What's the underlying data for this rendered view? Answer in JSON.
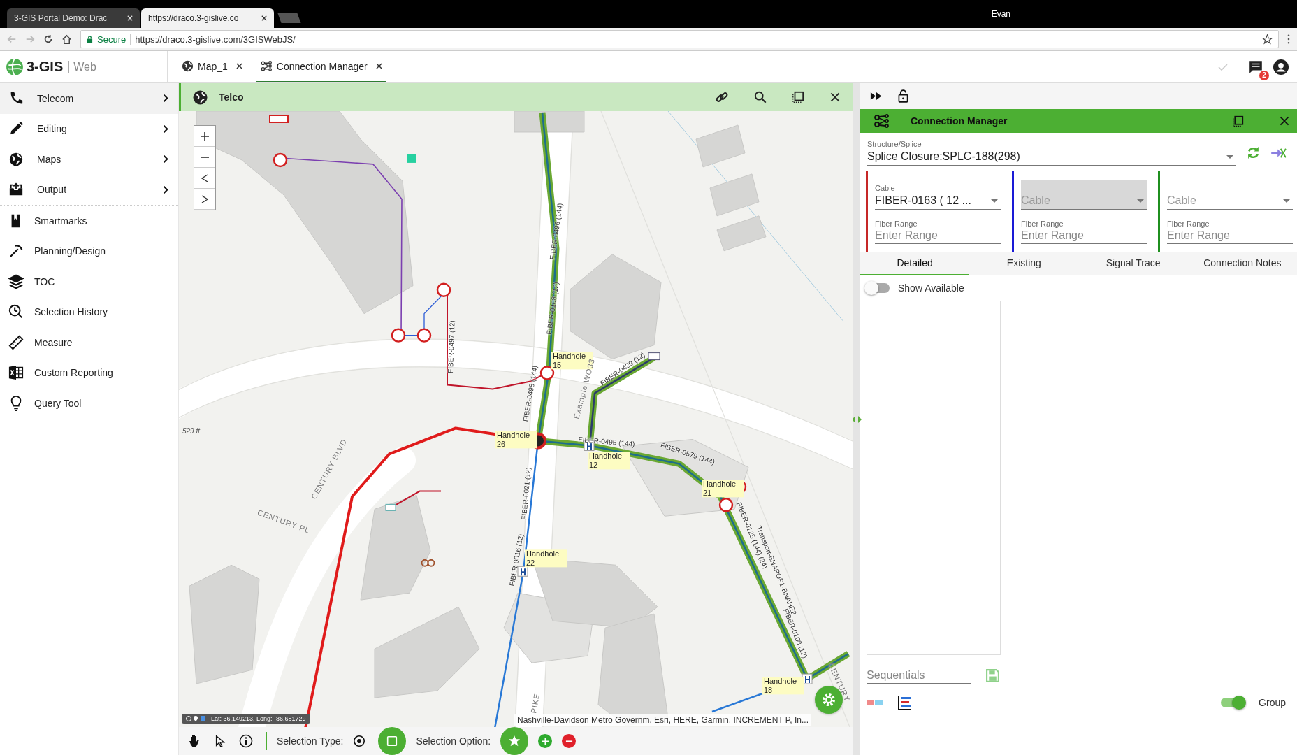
{
  "browser": {
    "tabs": [
      {
        "title": "3-GIS Portal Demo: Drac",
        "selected": false
      },
      {
        "title": "https://draco.3-gislive.co",
        "selected": true
      }
    ],
    "user": "Evan",
    "security": "Secure",
    "url": "https://draco.3-gislive.com/3GISWebJS/"
  },
  "app": {
    "logo": "3-GIS",
    "product": "Web",
    "tabs": [
      {
        "label": "Map_1",
        "selected": false
      },
      {
        "label": "Connection Manager",
        "selected": true
      }
    ],
    "notification_count": "2"
  },
  "sidebar": {
    "items": [
      {
        "label": "Telecom",
        "submenu": true,
        "selected": true
      },
      {
        "label": "Editing",
        "submenu": true,
        "selected": false
      },
      {
        "label": "Maps",
        "submenu": true,
        "selected": false
      },
      {
        "label": "Output",
        "submenu": true,
        "selected": false
      },
      {
        "label": "Smartmarks",
        "submenu": false,
        "selected": false
      },
      {
        "label": "Planning/Design",
        "submenu": false,
        "selected": false
      },
      {
        "label": "TOC",
        "submenu": false,
        "selected": false
      },
      {
        "label": "Selection History",
        "submenu": false,
        "selected": false
      },
      {
        "label": "Measure",
        "submenu": false,
        "selected": false
      },
      {
        "label": "Custom Reporting",
        "submenu": false,
        "selected": false
      },
      {
        "label": "Query Tool",
        "submenu": false,
        "selected": false
      }
    ]
  },
  "map_panel": {
    "title": "Telco",
    "scale": "529 ft",
    "coordinates": "Lat: 36.149213, Long: -86.681729",
    "attribution": "Nashville-Davidson Metro Governm, Esri, HERE, Garmin, INCREMENT P, In...",
    "labels": [
      {
        "kind": "fiber",
        "text": "FIBER-0496 (144)"
      },
      {
        "kind": "fiber",
        "text": "FIBER-0108 (12)"
      },
      {
        "kind": "fiber",
        "text": "FIBER-0497 (12)"
      },
      {
        "kind": "handhole",
        "text": "Handhole 15"
      },
      {
        "kind": "fiber",
        "text": "FIBER-0429 (12)"
      },
      {
        "kind": "road",
        "text": "Example WO33"
      },
      {
        "kind": "fiber",
        "text": "FIBER-0498 (144)"
      },
      {
        "kind": "handhole",
        "text": "Handhole 26"
      },
      {
        "kind": "fiber",
        "text": "FIBER-0495 (144)"
      },
      {
        "kind": "fiber",
        "text": "FIBER-0579 (144)"
      },
      {
        "kind": "handhole",
        "text": "Handhole 12"
      },
      {
        "kind": "road",
        "text": "CENTURY BLVD"
      },
      {
        "kind": "handhole",
        "text": "Handhole 21"
      },
      {
        "kind": "fiber",
        "text": "FIBER-0021 (12)"
      },
      {
        "kind": "road",
        "text": "CENTURY PL"
      },
      {
        "kind": "fiber",
        "text": "FIBER-0125 (144) (24)"
      },
      {
        "kind": "fiber",
        "text": "Transport-BNAPOP1-BNAHE2"
      },
      {
        "kind": "handhole",
        "text": "Handhole 22"
      },
      {
        "kind": "fiber",
        "text": "FIBER-0016 (12)"
      },
      {
        "kind": "fiber",
        "text": "FIBER-0108 (12)"
      },
      {
        "kind": "handhole",
        "text": "Handhole 18"
      },
      {
        "kind": "road",
        "text": "PIKE"
      },
      {
        "kind": "road",
        "text": "CENTURY"
      }
    ],
    "toolbar": {
      "selection_type": "Selection Type:",
      "selection_option": "Selection Option:"
    }
  },
  "connection_manager": {
    "title": "Connection Manager",
    "structure": {
      "label": "Structure/Splice",
      "value": "Splice Closure:SPLC-188(298)"
    },
    "cables": [
      {
        "color": "#c62828",
        "disabled": false,
        "label": "Cable",
        "value": "FIBER-0163 ( 12 ...",
        "range_label": "Fiber Range",
        "range_placeholder": "Enter Range"
      },
      {
        "color": "#1a1ad6",
        "disabled": true,
        "placeholder": "Cable",
        "range_label": "Fiber Range",
        "range_placeholder": "Enter Range"
      },
      {
        "color": "#1f8f1f",
        "disabled": false,
        "placeholder": "Cable",
        "range_label": "Fiber Range",
        "range_placeholder": "Enter Range"
      }
    ],
    "tabs": [
      {
        "label": "Detailed",
        "selected": true
      },
      {
        "label": "Existing",
        "selected": false
      },
      {
        "label": "Signal Trace",
        "selected": false
      },
      {
        "label": "Connection Notes",
        "selected": false
      }
    ],
    "show_available": {
      "label": "Show Available",
      "on": false
    },
    "sequentials": {
      "placeholder": "Sequentials"
    },
    "group": {
      "label": "Group",
      "on": true
    }
  }
}
